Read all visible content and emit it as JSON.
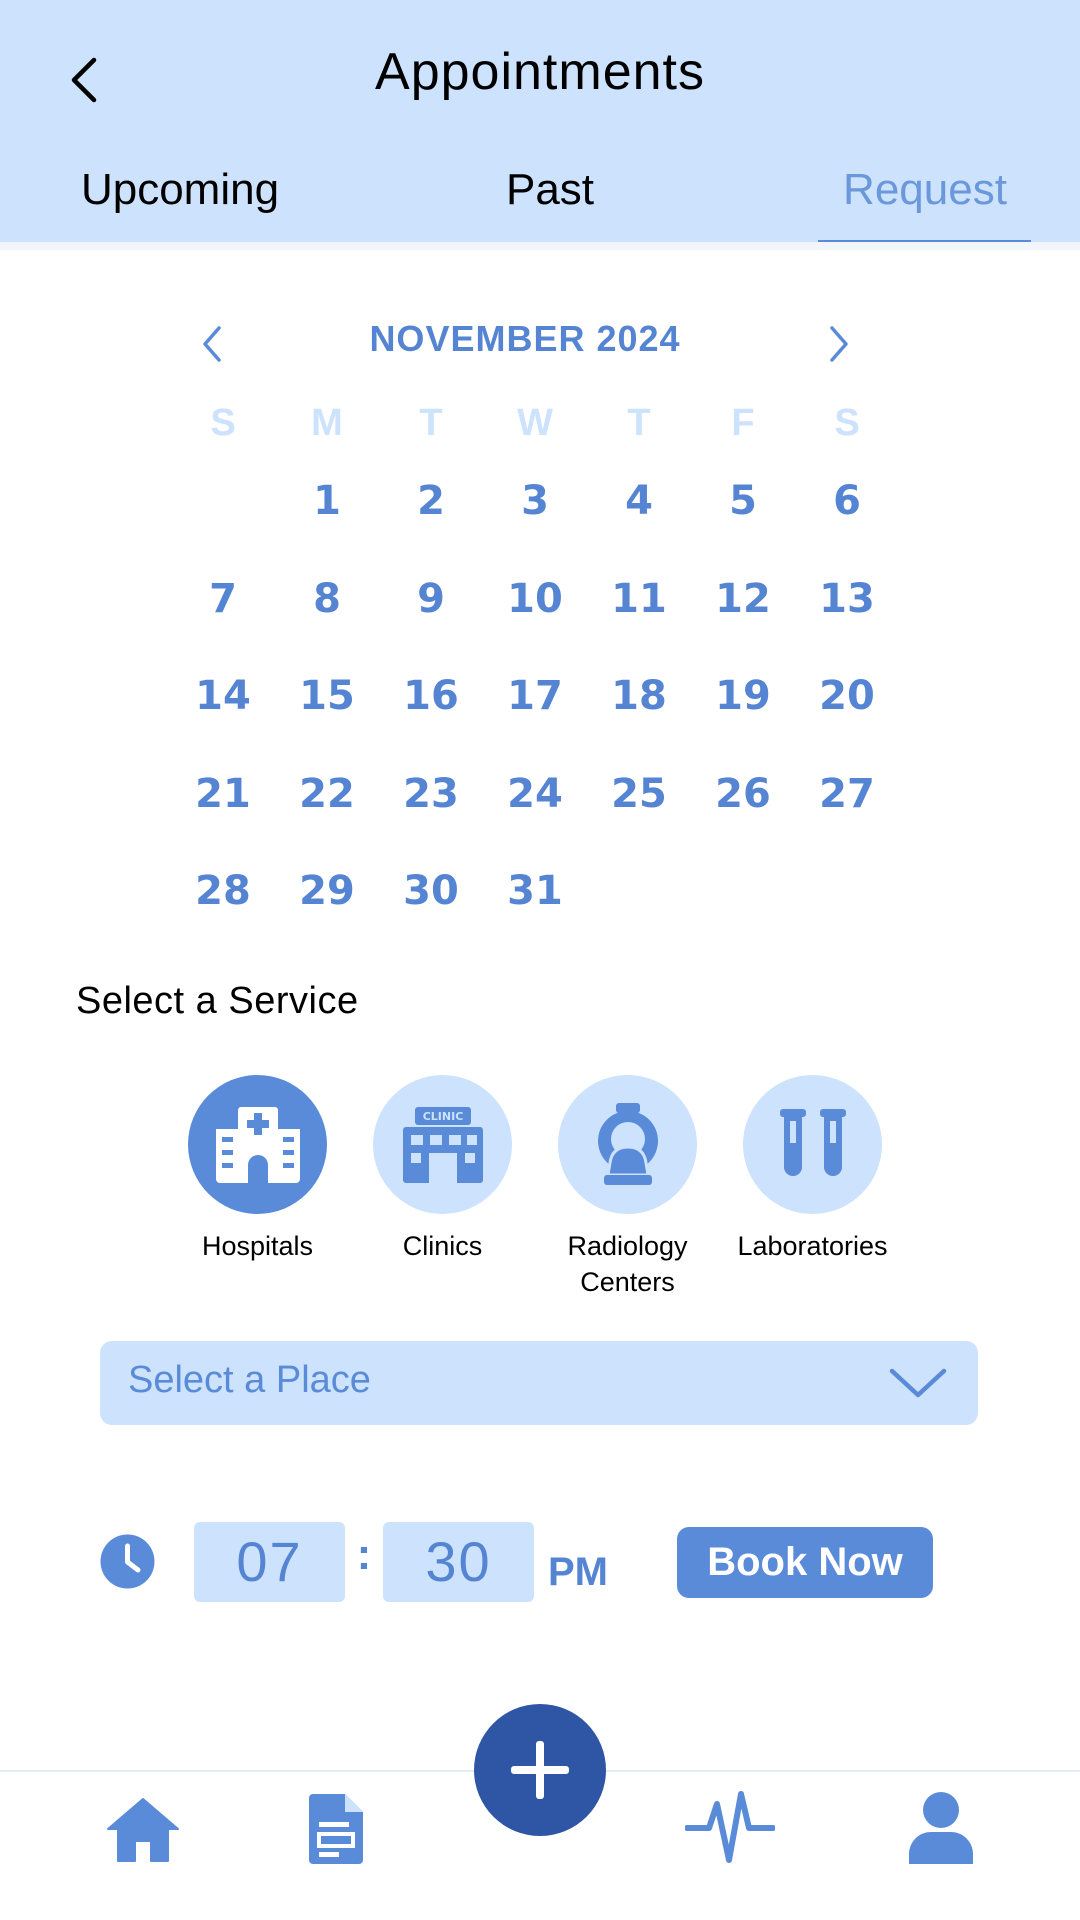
{
  "header": {
    "title": "Appointments",
    "tabs": [
      {
        "label": "Upcoming"
      },
      {
        "label": "Past"
      },
      {
        "label": "Request"
      }
    ],
    "active_tab": "Request"
  },
  "calendar": {
    "month_label": "NOVEMBER 2024",
    "weekdays": [
      "S",
      "M",
      "T",
      "W",
      "T",
      "F",
      "S"
    ],
    "leading_blank_days": 1,
    "days": [
      "1",
      "2",
      "3",
      "4",
      "5",
      "6",
      "7",
      "8",
      "9",
      "10",
      "11",
      "12",
      "13",
      "14",
      "15",
      "16",
      "17",
      "18",
      "19",
      "20",
      "21",
      "22",
      "23",
      "24",
      "25",
      "26",
      "27",
      "28",
      "29",
      "30",
      "31"
    ]
  },
  "services": {
    "title": "Select a Service",
    "items": [
      {
        "label": "Hospitals",
        "icon": "hospital-icon",
        "selected": true
      },
      {
        "label": "Clinics",
        "icon": "clinic-icon",
        "selected": false,
        "icon_text": "CLINIC"
      },
      {
        "label_line1": "Radiology",
        "label_line2": "Centers",
        "icon": "radiology-icon",
        "selected": false
      },
      {
        "label": "Laboratories",
        "icon": "test-tubes-icon",
        "selected": false
      }
    ]
  },
  "place": {
    "placeholder": "Select a Place"
  },
  "time": {
    "hour": "07",
    "minute": "30",
    "separator": ":",
    "period": "PM"
  },
  "book_button": {
    "label": "Book Now"
  },
  "bottom_nav": {
    "items": [
      "home-icon",
      "document-icon",
      "add-icon",
      "activity-icon",
      "profile-icon"
    ]
  },
  "colors": {
    "header_bg": "#cce2fd",
    "accent": "#5a8bd8",
    "fab": "#2e56a4"
  }
}
